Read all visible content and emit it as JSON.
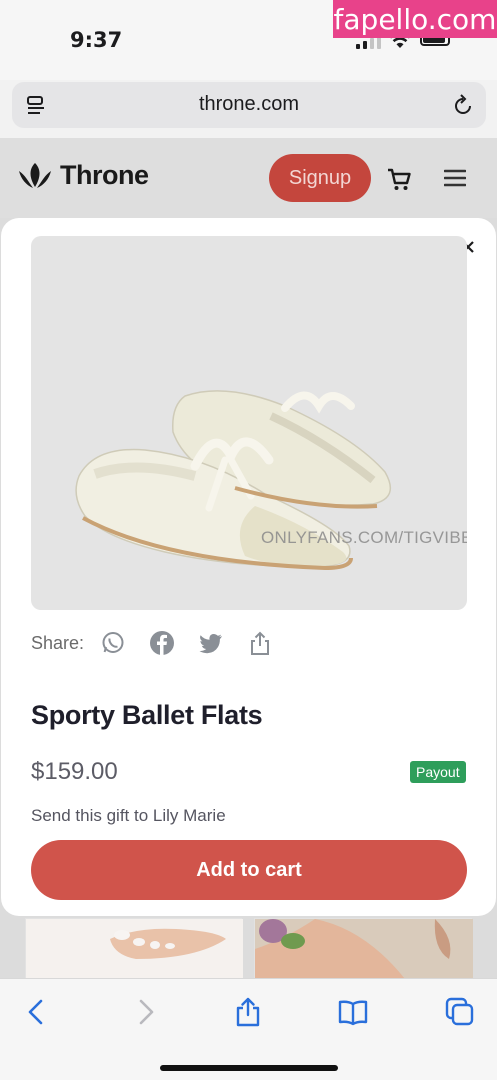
{
  "status_bar": {
    "time": "9:37",
    "watermark": "fapello.com"
  },
  "address_bar": {
    "url": "throne.com"
  },
  "site_header": {
    "brand": "Throne",
    "signup_label": "Signup",
    "colors": {
      "signup_bg": "#c4463d"
    }
  },
  "modal": {
    "image_watermark": "ONLYFANS.COM/TIGVIBES",
    "share": {
      "label": "Share:",
      "icons": [
        "whatsapp-icon",
        "facebook-icon",
        "twitter-icon",
        "share-icon"
      ]
    },
    "product": {
      "title": "Sporty Ballet Flats",
      "price": "$159.00",
      "badge": "Payout",
      "gift_text": "Send this gift to Lily Marie"
    },
    "add_to_cart_label": "Add to cart",
    "colors": {
      "accent": "#d0544b",
      "badge": "#2e9e5b"
    }
  },
  "toolbar": {
    "icons": [
      "back-icon",
      "forward-icon",
      "share-icon",
      "bookmarks-icon",
      "tabs-icon"
    ]
  }
}
